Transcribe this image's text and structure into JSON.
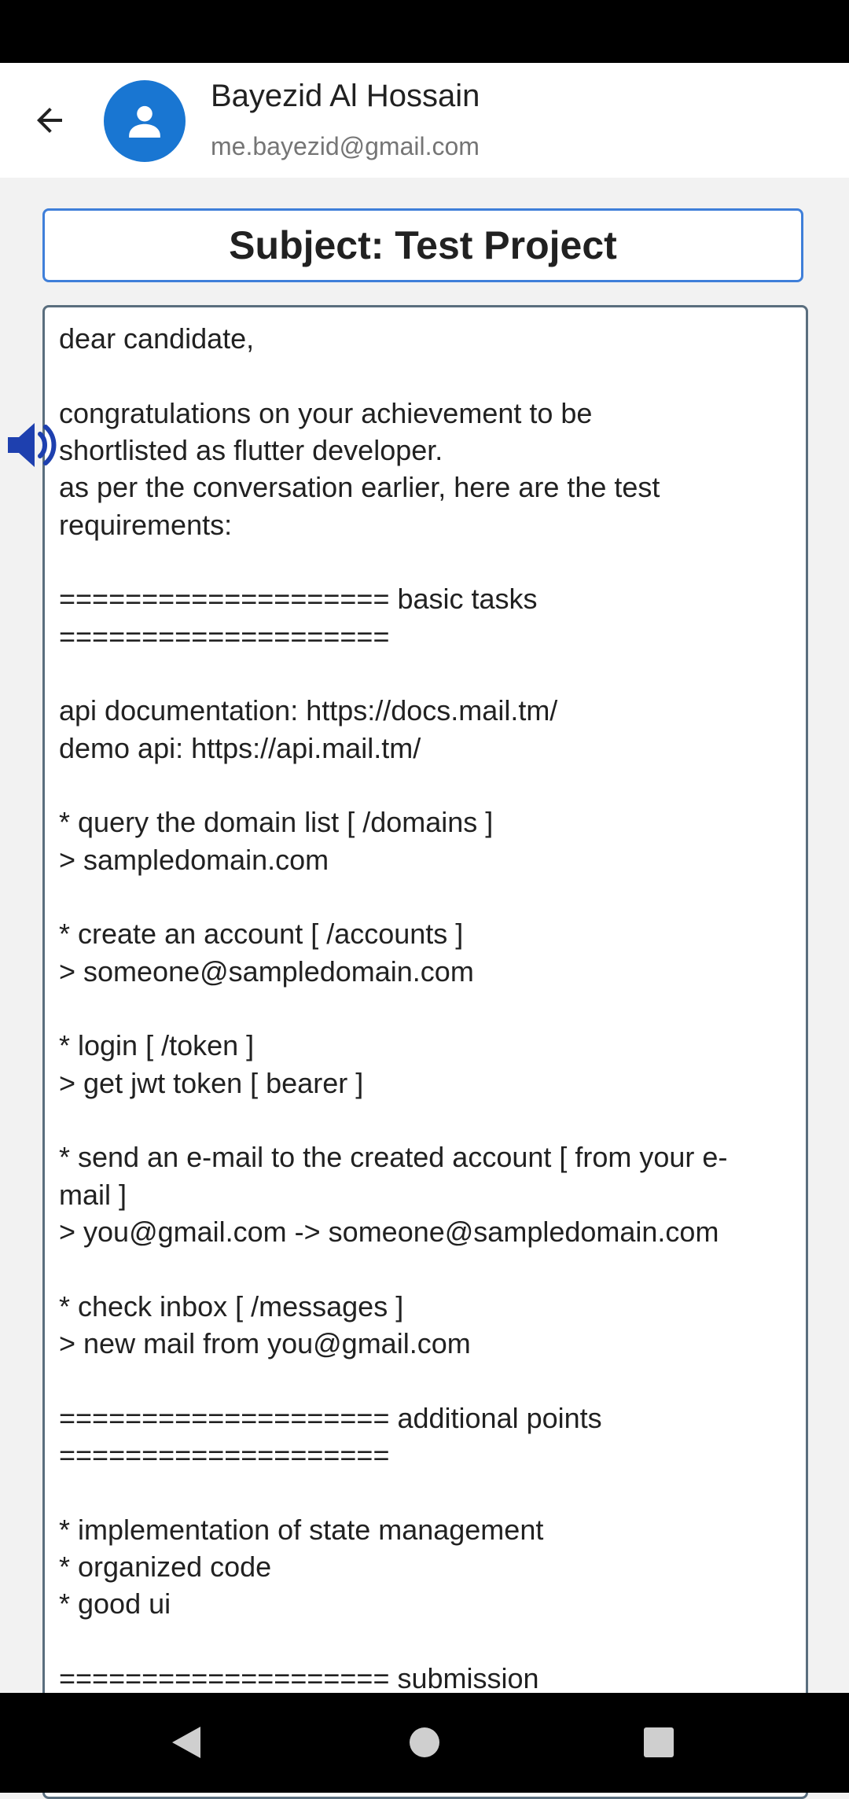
{
  "header": {
    "back_icon": "arrow-back-icon",
    "avatar_icon": "person-icon",
    "sender_name": "Bayezid Al Hossain",
    "sender_email": "me.bayezid@gmail.com",
    "accent_color": "#1976d2"
  },
  "subject": {
    "text": "Subject: Test Project",
    "border_color": "#3f7fd9"
  },
  "body": {
    "lines": [
      "dear candidate,",
      "",
      "congratulations on your achievement to be",
      "shortlisted as flutter developer.",
      "as per the conversation earlier, here are the test",
      "requirements:",
      "",
      "==================== basic tasks",
      "====================",
      "",
      "api documentation: https://docs.mail.tm/",
      "demo api: https://api.mail.tm/",
      "",
      "* query the domain list [ /domains ]",
      "> sampledomain.com",
      "",
      "* create an account [ /accounts ]",
      "> someone@sampledomain.com",
      "",
      "* login [ /token ]",
      "> get jwt token [ bearer ]",
      "",
      "* send an e-mail to the created account [ from your e-",
      "mail ]",
      "> you@gmail.com -> someone@sampledomain.com",
      "",
      "* check inbox [ /messages ]",
      "> new mail from you@gmail.com",
      "",
      "==================== additional points",
      "====================",
      "",
      "* implementation of state management",
      "* organized code",
      "* good ui",
      "",
      "==================== submission"
    ]
  },
  "floating": {
    "speaker_icon": "speaker-volume-icon",
    "speaker_color": "#1e40af"
  },
  "navbar": {
    "back_icon": "nav-back-triangle-icon",
    "home_icon": "nav-home-circle-icon",
    "recents_icon": "nav-recents-square-icon"
  }
}
